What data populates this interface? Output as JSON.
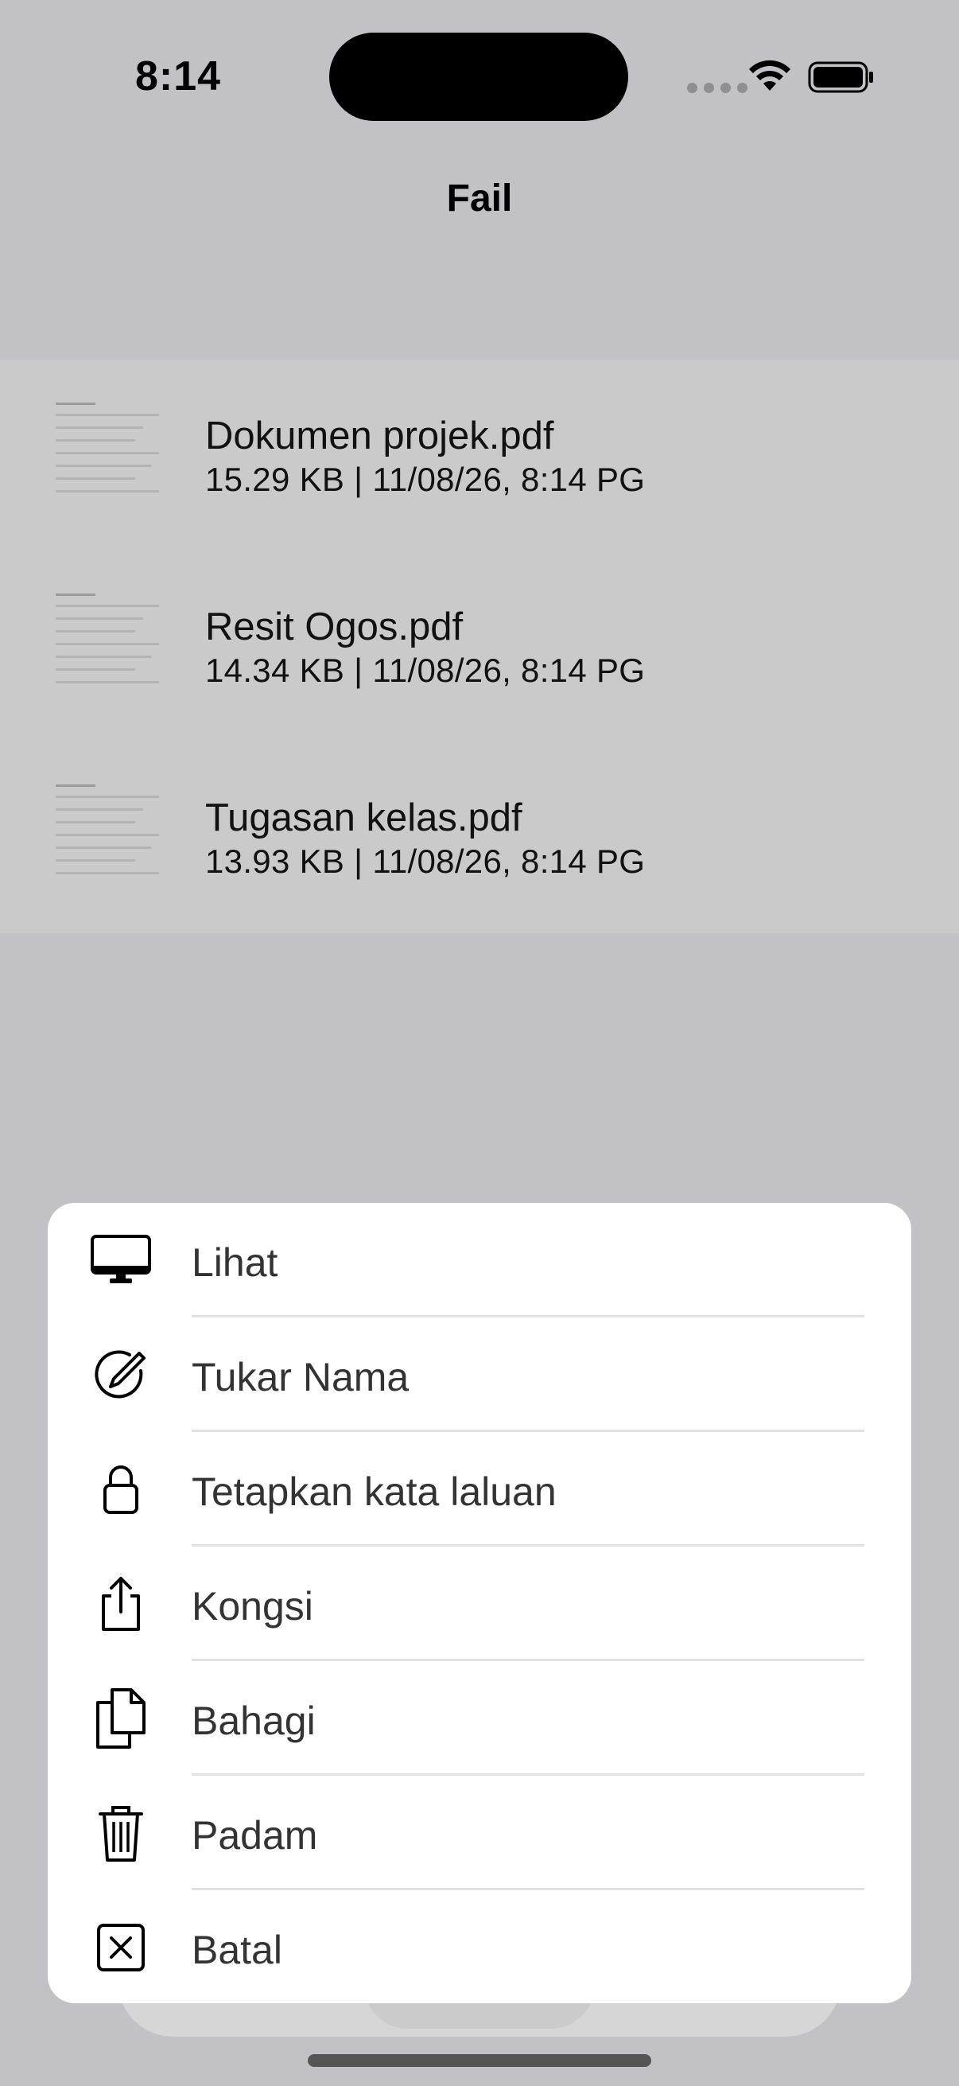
{
  "status_bar": {
    "time": "8:14"
  },
  "header": {
    "title": "Fail"
  },
  "files": [
    {
      "name": "Dokumen projek.pdf",
      "meta": "15.29 KB | 11/08/26, 8:14 PG"
    },
    {
      "name": "Resit Ogos.pdf",
      "meta": "14.34 KB | 11/08/26, 8:14 PG"
    },
    {
      "name": "Tugasan kelas.pdf",
      "meta": "13.93 KB | 11/08/26, 8:14 PG"
    }
  ],
  "action_sheet": {
    "items": [
      {
        "label": "Lihat",
        "icon": "display-icon"
      },
      {
        "label": "Tukar Nama",
        "icon": "rename-pencil-icon"
      },
      {
        "label": "Tetapkan kata laluan",
        "icon": "lock-icon"
      },
      {
        "label": "Kongsi",
        "icon": "share-icon"
      },
      {
        "label": "Bahagi",
        "icon": "split-documents-icon"
      },
      {
        "label": "Padam",
        "icon": "trash-icon"
      },
      {
        "label": "Batal",
        "icon": "cancel-x-icon"
      }
    ]
  },
  "colors": {
    "backdrop": "#c1c1c6",
    "list_background": "#cacaca",
    "sheet_background": "#ffffff"
  }
}
